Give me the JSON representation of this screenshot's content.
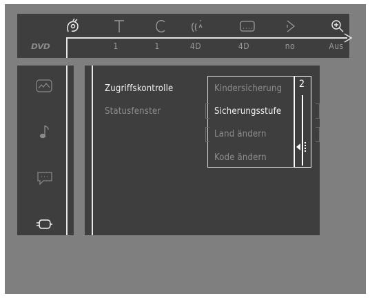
{
  "status_bar": {
    "icons": [
      "viewing-angle-icon",
      "title-icon",
      "chapter-icon",
      "audio-icon",
      "subtitle-icon",
      "repeat-icon",
      "zoom-icon"
    ],
    "logo": "DVD",
    "values": [
      "1",
      "1",
      "4D",
      "4D",
      "no",
      "Aus"
    ]
  },
  "sidebar": {
    "icons": [
      "picture-icon",
      "music-note-icon",
      "speech-bubble-icon",
      "plug-icon"
    ]
  },
  "menu": {
    "item_1": "Zugriffskontrolle",
    "item_2": "Statusfenster"
  },
  "submenu": {
    "item_1": "Kindersicherung",
    "item_2": "Sicherungsstufe",
    "item_3": "Land ändern",
    "item_4": "Kode ändern"
  },
  "level": {
    "value": "2"
  },
  "colors": {
    "background": "#7f7f7f",
    "panel": "#3e3e3e",
    "highlight": "#f2f2f2",
    "dim_text": "#8d8d8d"
  }
}
